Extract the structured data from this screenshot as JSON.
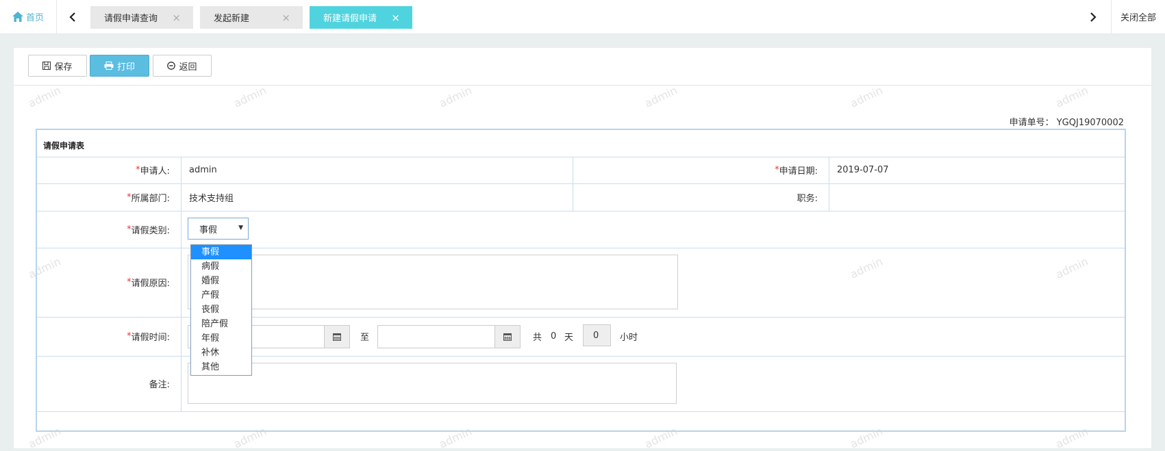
{
  "tabs": {
    "home": "首页",
    "items": [
      {
        "label": "请假申请查询",
        "close": "×"
      },
      {
        "label": "发起新建",
        "close": "×"
      },
      {
        "label": "新建请假申请",
        "close": "×"
      }
    ],
    "close_all": "关闭全部"
  },
  "toolbar": {
    "save": "保存",
    "print": "打印",
    "back": "返回"
  },
  "watermark": "admin",
  "application_no": "申请单号： YGQJ19070002",
  "form": {
    "title": "请假申请表",
    "required_mark": "*",
    "applicant_label": "申请人:",
    "applicant_value": "admin",
    "date_label": "申请日期:",
    "date_value": "2019-07-07",
    "dept_label": "所属部门:",
    "dept_value": "技术支持组",
    "position_label": "职务:",
    "position_value": "",
    "type_label": "请假类别:",
    "type_value": "事假",
    "reason_label": "请假原因:",
    "time_label": "请假时间:",
    "to_label": "至",
    "total_prefix": "共",
    "days_value": "0",
    "days_unit": "天",
    "hours_value": "0",
    "hours_unit": "小时",
    "remark_label": "备注:"
  },
  "dropdown_options": [
    "事假",
    "病假",
    "婚假",
    "产假",
    "丧假",
    "陪产假",
    "年假",
    "补休",
    "其他"
  ],
  "colors": {
    "accent": "#4fd3de",
    "primary_button": "#5bbde0",
    "form_border": "#b9d3ea",
    "required": "#ee3333"
  }
}
